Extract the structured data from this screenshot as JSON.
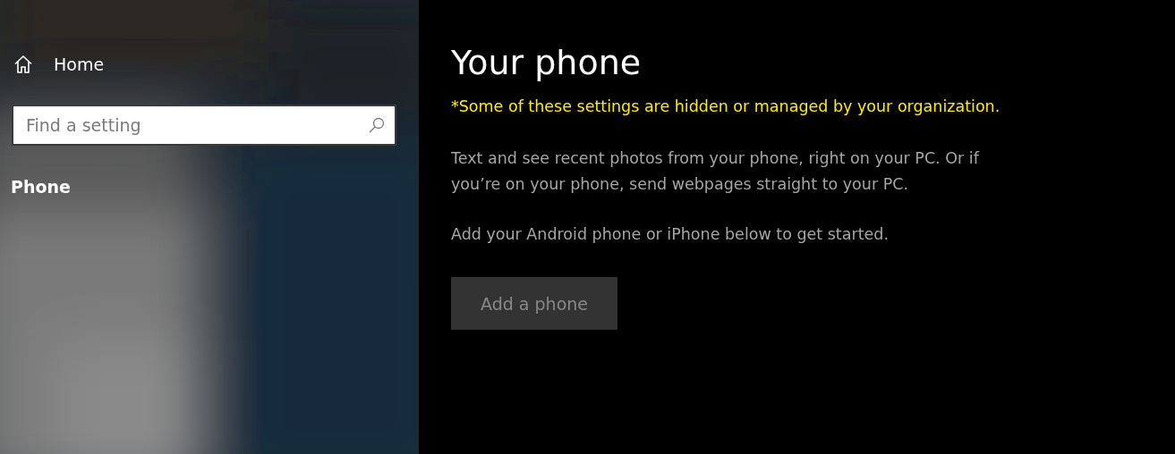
{
  "sidebar": {
    "home": {
      "label": "Home"
    },
    "search": {
      "placeholder": "Find a setting"
    },
    "section_title": "Phone"
  },
  "content": {
    "title": "Your phone",
    "notice": "*Some of these settings are hidden or managed by your organization.",
    "paragraphs": [
      "Text and see recent photos from your phone, right on your PC. Or if you’re on your phone, send webpages straight to your PC.",
      "Add your Android phone or iPhone below to get started."
    ],
    "button": {
      "label": "Add a phone",
      "disabled": true
    }
  }
}
